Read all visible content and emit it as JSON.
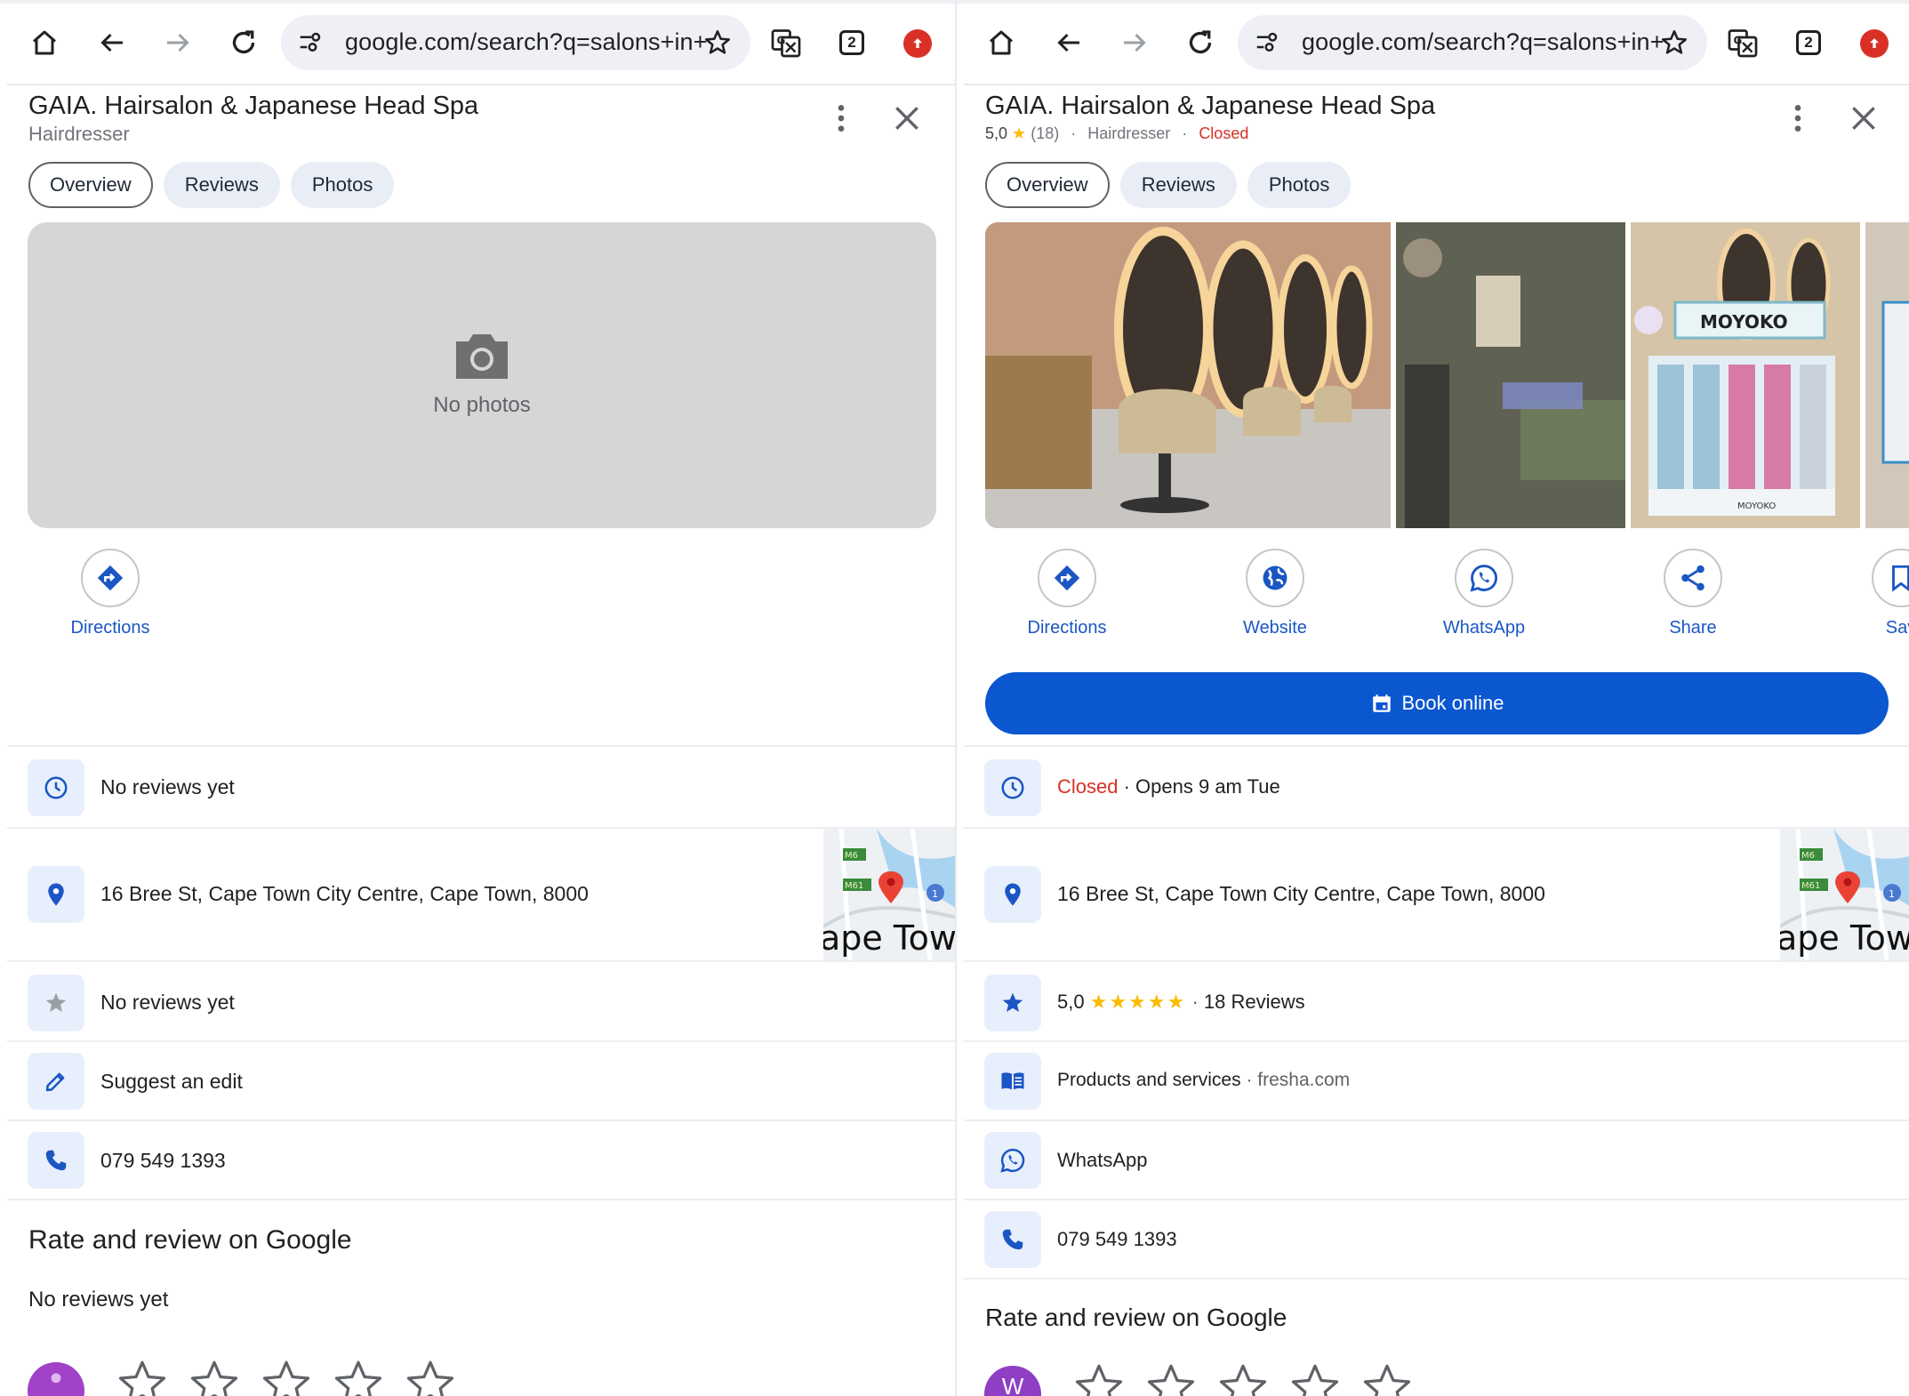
{
  "browser": {
    "url": "google.com/search?q=salons+in+",
    "tab_count": "2"
  },
  "left": {
    "title": "GAIA. Hairsalon & Japanese Head Spa",
    "category": "Hairdresser",
    "tabs": [
      "Overview",
      "Reviews",
      "Photos"
    ],
    "no_photos": "No photos",
    "actions": {
      "directions": "Directions"
    },
    "rows": {
      "hours": "No reviews yet",
      "address": "16 Bree St, Cape Town City Centre, Cape Town, 8000",
      "reviews": "No reviews yet",
      "suggest": "Suggest an edit",
      "phone": "079 549 1393"
    },
    "rate_title": "Rate and review on Google",
    "rate_sub": "No reviews yet"
  },
  "right": {
    "title": "GAIA. Hairsalon & Japanese Head Spa",
    "rating": "5,0",
    "rating_count": "(18)",
    "category": "Hairdresser",
    "status": "Closed",
    "tabs": [
      "Overview",
      "Reviews",
      "Photos"
    ],
    "actions": {
      "directions": "Directions",
      "website": "Website",
      "whatsapp": "WhatsApp",
      "share": "Share",
      "save": "Sav"
    },
    "book_online": "Book online",
    "rows": {
      "hours_status": "Closed",
      "hours_rest": " · Opens 9 am Tue",
      "address": "16 Bree St, Cape Town City Centre, Cape Town, 8000",
      "rating": "5,0",
      "rating_stars": "★★★★★",
      "reviews_count": "18 Reviews",
      "products": "Products and services",
      "products_site": "fresha.com",
      "whatsapp": "WhatsApp",
      "phone": "079 549 1393"
    },
    "rate_title": "Rate and review on Google",
    "avatar_letter": "W"
  },
  "map": {
    "label": "ape Town",
    "road_1": "M6",
    "road_2": "M61",
    "road_3": "1"
  },
  "photo": {
    "brand": "MOYOKO",
    "brand_small": "MOYOKO"
  },
  "colors": {
    "accent": "#0b57d0",
    "closed": "#d93025",
    "star": "#fbbc04"
  }
}
